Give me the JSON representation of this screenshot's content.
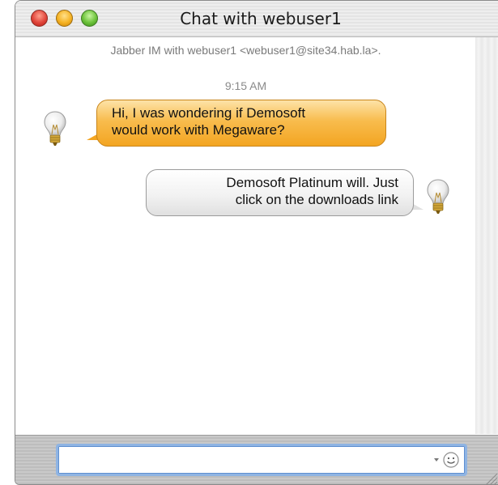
{
  "window": {
    "title": "Chat with webuser1"
  },
  "transcript": {
    "header": "Jabber IM with webuser1 <webuser1@site34.hab.la>.",
    "timestamp": "9:15 AM",
    "messages": [
      {
        "from": "them",
        "text_lines": [
          "Hi, I was wondering if Demosoft",
          "would work with Megaware?"
        ]
      },
      {
        "from": "me",
        "text_lines": [
          "Demosoft Platinum will. Just",
          "click on the downloads link"
        ]
      }
    ]
  },
  "input": {
    "value": "",
    "placeholder": ""
  },
  "icons": {
    "avatar": "lightbulb-icon",
    "emoticon": "smiley-icon",
    "dropdown": "chevron-down-icon"
  },
  "colors": {
    "incoming_bubble": "#f8bc4d",
    "outgoing_bubble": "#f2f2f2",
    "input_focus": "#8fb4e3"
  }
}
